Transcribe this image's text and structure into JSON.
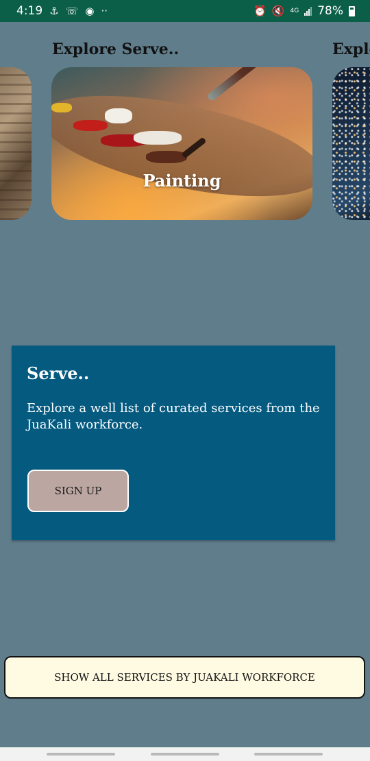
{
  "status_bar": {
    "time": "4:19",
    "network": "4G",
    "battery": "78%",
    "left_icons": [
      "usb-debug-icon",
      "whatsapp-icon",
      "headset-icon",
      "more-dots-icon"
    ],
    "right_icons": [
      "alarm-icon",
      "mute-icon",
      "network-4g-icon",
      "signal-icon",
      "battery-icon"
    ]
  },
  "carousel": {
    "items": [
      {
        "title": "",
        "label": "",
        "image": "wood-texture"
      },
      {
        "title": "Explore Serve..",
        "label": "Painting",
        "image": "painting-palette"
      },
      {
        "title": "Explo",
        "label": "",
        "image": "welding-sparks"
      }
    ]
  },
  "panel": {
    "title": "Serve..",
    "description": "Explore a well list of curated services from the JuaKali workforce.",
    "button_label": "SIGN UP",
    "background": "#055a80"
  },
  "footer": {
    "button_label": "SHOW ALL SERVICES BY JUAKALI WORKFORCE"
  },
  "colors": {
    "page_background": "#607d8b",
    "status_bar": "#0b5e47",
    "signup_button": "#bca6a2",
    "show_all_button": "#fffbe3"
  }
}
